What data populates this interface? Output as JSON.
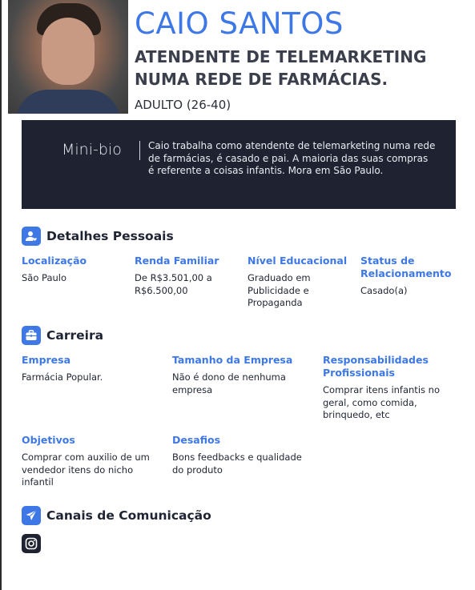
{
  "header": {
    "name": "CAIO SANTOS",
    "role": "ATENDENTE DE TELEMARKETING NUMA REDE DE FARMÁCIAS.",
    "age_group": "ADULTO (26-40)"
  },
  "bio": {
    "title": "Mini-bio",
    "text": "Caio trabalha como atendente de telemarketing numa rede de farmácias, é casado e pai. A maioria das suas compras é referente a coisas infantis. Mora em São Paulo."
  },
  "personal": {
    "title": "Detalhes Pessoais",
    "fields": [
      {
        "label": "Localização",
        "value": "São Paulo"
      },
      {
        "label": "Renda Familiar",
        "value": "De R$3.501,00 a R$6.500,00"
      },
      {
        "label": "Nível Educacional",
        "value": "Graduado em Publicidade e Propaganda"
      },
      {
        "label": "Status de Relacionamento",
        "value": "Casado(a)"
      }
    ]
  },
  "career": {
    "title": "Carreira",
    "fields": [
      {
        "label": "Empresa",
        "value": "Farmácia Popular."
      },
      {
        "label": "Tamanho da Empresa",
        "value": "Não é dono de nenhuma empresa"
      },
      {
        "label": "Responsabilidades Profissionais",
        "value": "Comprar itens infantis no geral, como comida, brinquedo, etc"
      },
      {
        "label": "Objetivos",
        "value": "Comprar com auxilio de um vendedor itens do nicho infantil"
      },
      {
        "label": "Desafios",
        "value": "Bons feedbacks e qualidade do produto"
      }
    ]
  },
  "channels": {
    "title": "Canais de Comunicação",
    "icons": [
      "instagram-icon"
    ]
  },
  "colors": {
    "accent": "#3d78e6",
    "dark_panel": "#1f2331"
  }
}
